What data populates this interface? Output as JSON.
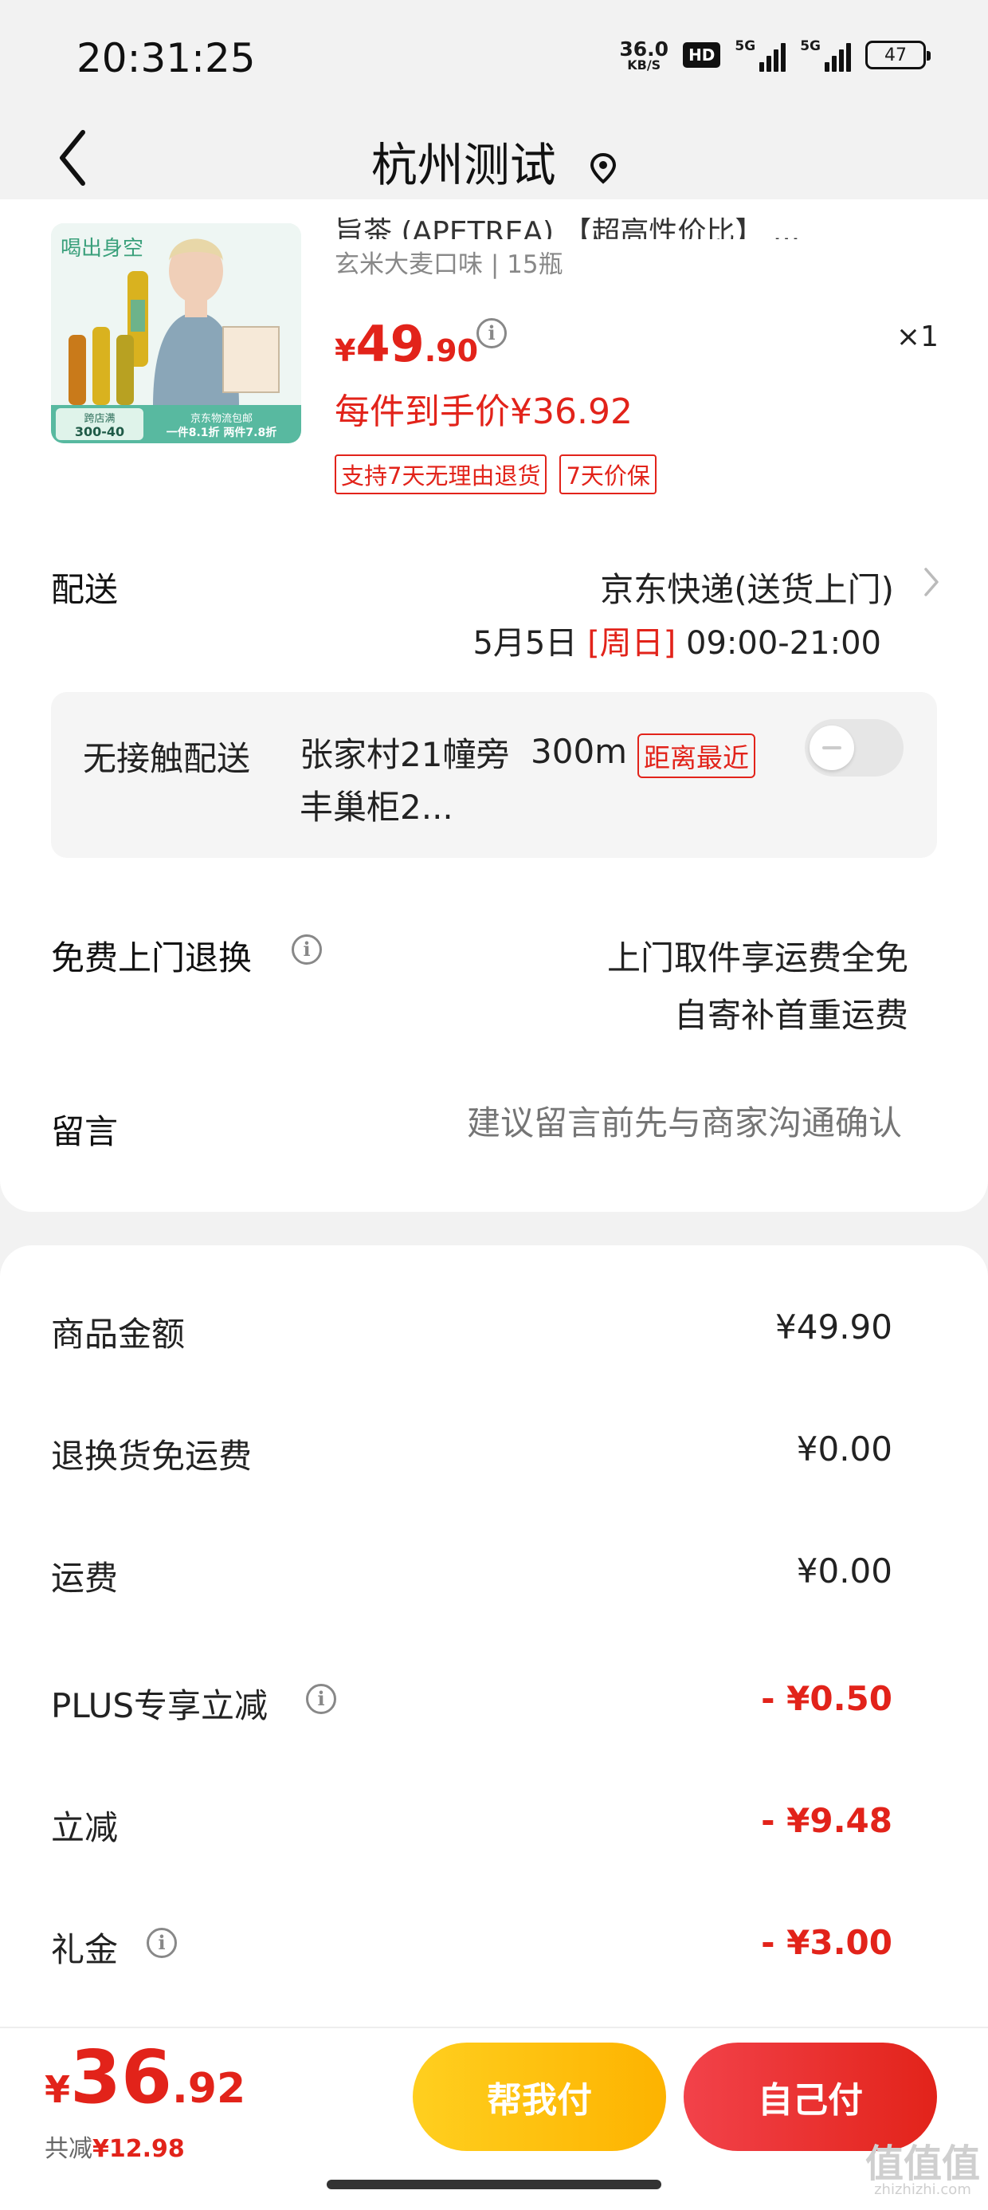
{
  "status_bar": {
    "time": "20:31:25",
    "net_speed": "36.0",
    "net_unit": "KB/S",
    "hd": "HD",
    "signal1": "5G",
    "signal2": "5G",
    "battery": "47"
  },
  "header": {
    "title": "杭州测试",
    "back_icon": "chevron-left-icon",
    "location_icon": "location-pin-icon"
  },
  "product": {
    "name": "旨茶 (APETREA) 【超高性价比】 ...",
    "spec": "玄米大麦口味 | 15瓶",
    "price_currency": "¥",
    "price_int": "49",
    "price_dec": ".90",
    "quantity": "×1",
    "unit_price": "每件到手价¥36.92",
    "tags": [
      "支持7天无理由退货",
      "7天价保"
    ],
    "image": {
      "text_left": "喝出身空",
      "promo1_title": "跨店满",
      "promo1_value": "300-40",
      "promo2_title": "京东物流包邮",
      "promo2_value": "一件8.1折 两件7.8折"
    }
  },
  "shipping": {
    "label": "配送",
    "method": "京东快递(送货上门)",
    "date": "5月5日",
    "day": "[周日]",
    "time": "09:00-21:00"
  },
  "contactless": {
    "label": "无接触配送",
    "address": "张家村21幢旁丰巢柜2...",
    "distance": "300m",
    "badge": "距离最近",
    "toggle_on": false
  },
  "returns": {
    "label": "免费上门退换",
    "line1": "上门取件享运费全免",
    "line2": "自寄补首重运费"
  },
  "message": {
    "label": "留言",
    "placeholder": "建议留言前先与商家沟通确认"
  },
  "summary": [
    {
      "label": "商品金额",
      "value": "¥49.90",
      "red": false,
      "info": false
    },
    {
      "label": "退换货免运费",
      "value": "¥0.00",
      "red": false,
      "info": false
    },
    {
      "label": "运费",
      "value": "¥0.00",
      "red": false,
      "info": false
    },
    {
      "label": "PLUS专享立减",
      "value": "- ¥0.50",
      "red": true,
      "info": true
    },
    {
      "label": "立减",
      "value": "- ¥9.48",
      "red": true,
      "info": false
    },
    {
      "label": "礼金",
      "value": "- ¥3.00",
      "red": true,
      "info": true
    }
  ],
  "footer": {
    "total_currency": "¥",
    "total_int": "36",
    "total_dec": ".92",
    "saved_label": "共减",
    "saved_value": "¥12.98",
    "help_pay": "帮我付",
    "self_pay": "自己付"
  },
  "watermark": {
    "main": "值值值",
    "sub": "zhizhizhi.com"
  },
  "colors": {
    "accent_red": "#e2231a",
    "yellow": "#fdb300",
    "background": "#f2f2f2"
  }
}
